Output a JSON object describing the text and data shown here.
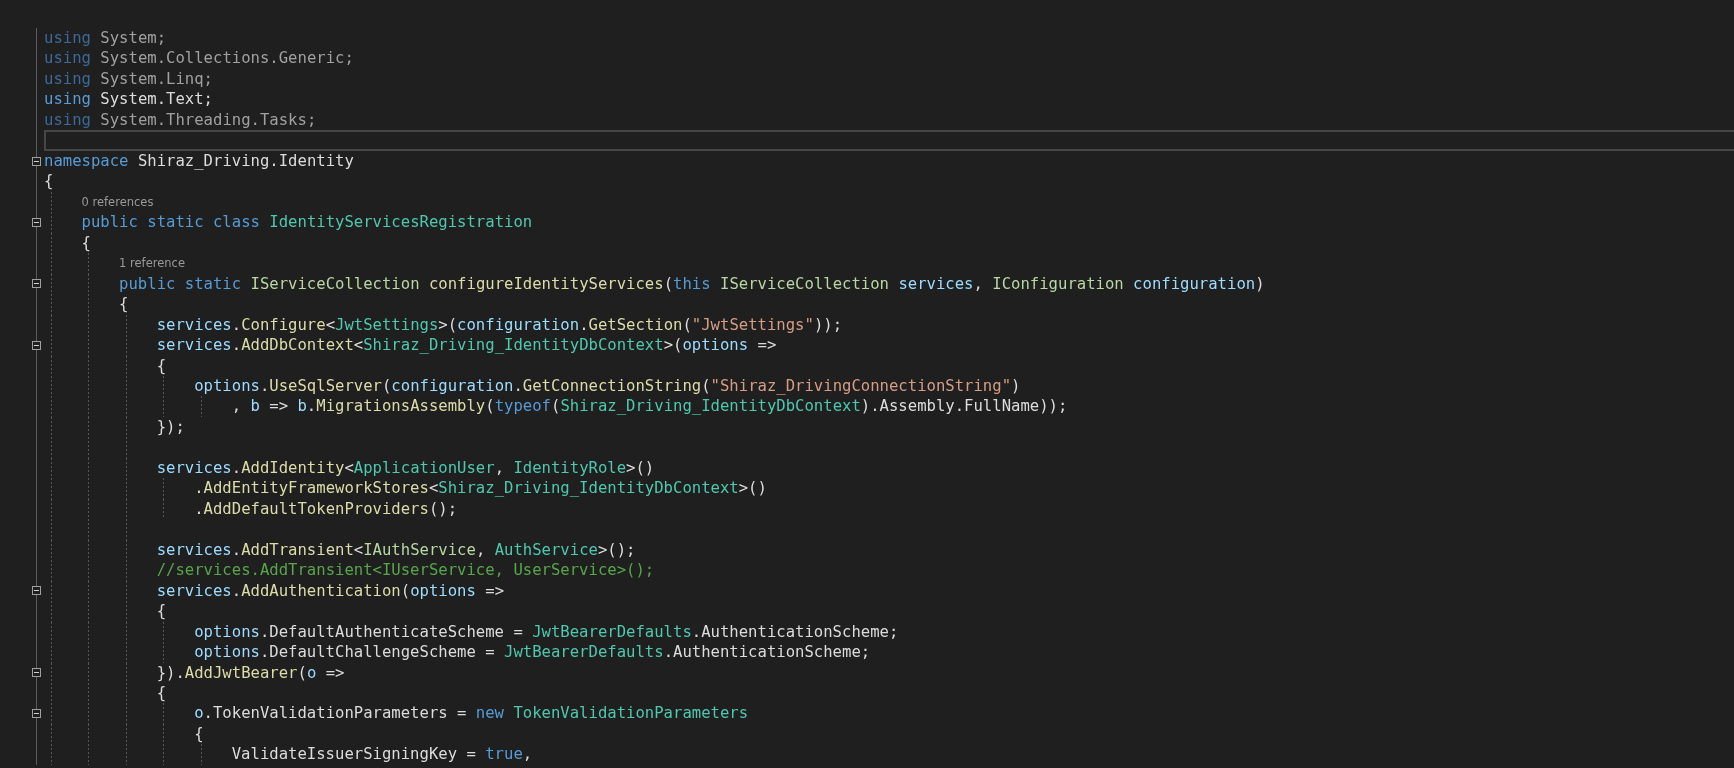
{
  "editor": {
    "lines": [
      {
        "kind": "code",
        "fold": false,
        "current": false,
        "tokens": [
          {
            "text": "using",
            "kind": "kw_dim"
          },
          {
            "text": " System;",
            "kind": "dim"
          }
        ]
      },
      {
        "kind": "code",
        "fold": false,
        "current": false,
        "tokens": [
          {
            "text": "using",
            "kind": "kw_dim"
          },
          {
            "text": " System.Collections.Generic;",
            "kind": "dim"
          }
        ]
      },
      {
        "kind": "code",
        "fold": false,
        "current": false,
        "tokens": [
          {
            "text": "using",
            "kind": "kw_dim"
          },
          {
            "text": " System.Linq;",
            "kind": "dim"
          }
        ]
      },
      {
        "kind": "code",
        "fold": false,
        "current": false,
        "tokens": [
          {
            "text": "using",
            "kind": "kw"
          },
          {
            "text": " System.Text;",
            "kind": "plain"
          }
        ]
      },
      {
        "kind": "code",
        "fold": false,
        "current": false,
        "tokens": [
          {
            "text": "using",
            "kind": "kw_dim"
          },
          {
            "text": " System.Threading.Tasks;",
            "kind": "dim"
          }
        ]
      },
      {
        "kind": "blank",
        "fold": false,
        "current": true
      },
      {
        "kind": "code",
        "fold": true,
        "current": false,
        "tokens": [
          {
            "text": "namespace",
            "kind": "kw"
          },
          {
            "text": " Shiraz_Driving.Identity",
            "kind": "plain"
          }
        ]
      },
      {
        "kind": "code",
        "fold": false,
        "current": false,
        "tokens": [
          {
            "text": "{",
            "kind": "plain"
          }
        ],
        "children": [
          {
            "kind": "codelens",
            "fold": false,
            "current": false,
            "text": "0 references"
          },
          {
            "kind": "code",
            "fold": true,
            "current": false,
            "tokens": [
              {
                "text": "public static class",
                "kind": "kw"
              },
              {
                "text": " IdentityServicesRegistration",
                "kind": "type"
              }
            ]
          },
          {
            "kind": "code",
            "fold": false,
            "current": false,
            "tokens": [
              {
                "text": "{",
                "kind": "plain"
              }
            ],
            "children": [
              {
                "kind": "codelens",
                "fold": false,
                "current": false,
                "text": "1 reference"
              },
              {
                "kind": "code",
                "fold": true,
                "current": false,
                "tokens": [
                  {
                    "text": "public static",
                    "kind": "kw"
                  },
                  {
                    "text": " IServiceCollection",
                    "kind": "iface"
                  },
                  {
                    "text": " configureIdentityServices",
                    "kind": "method"
                  },
                  {
                    "text": "(",
                    "kind": "plain"
                  },
                  {
                    "text": "this",
                    "kind": "kw"
                  },
                  {
                    "text": " IServiceCollection",
                    "kind": "iface"
                  },
                  {
                    "text": " services",
                    "kind": "var"
                  },
                  {
                    "text": ", ",
                    "kind": "plain"
                  },
                  {
                    "text": "IConfiguration",
                    "kind": "iface"
                  },
                  {
                    "text": " configuration",
                    "kind": "var"
                  },
                  {
                    "text": ")",
                    "kind": "plain"
                  }
                ]
              },
              {
                "kind": "code",
                "fold": false,
                "current": false,
                "tokens": [
                  {
                    "text": "{",
                    "kind": "plain"
                  }
                ],
                "children": [
                  {
                    "kind": "code",
                    "fold": false,
                    "current": false,
                    "tokens": [
                      {
                        "text": "services",
                        "kind": "var"
                      },
                      {
                        "text": ".",
                        "kind": "plain"
                      },
                      {
                        "text": "Configure",
                        "kind": "method"
                      },
                      {
                        "text": "<",
                        "kind": "plain"
                      },
                      {
                        "text": "JwtSettings",
                        "kind": "type"
                      },
                      {
                        "text": ">(",
                        "kind": "plain"
                      },
                      {
                        "text": "configuration",
                        "kind": "var"
                      },
                      {
                        "text": ".",
                        "kind": "plain"
                      },
                      {
                        "text": "GetSection",
                        "kind": "method"
                      },
                      {
                        "text": "(",
                        "kind": "plain"
                      },
                      {
                        "text": "\"JwtSettings\"",
                        "kind": "str"
                      },
                      {
                        "text": "));",
                        "kind": "plain"
                      }
                    ]
                  },
                  {
                    "kind": "code",
                    "fold": true,
                    "current": false,
                    "tokens": [
                      {
                        "text": "services",
                        "kind": "var"
                      },
                      {
                        "text": ".",
                        "kind": "plain"
                      },
                      {
                        "text": "AddDbContext",
                        "kind": "method"
                      },
                      {
                        "text": "<",
                        "kind": "plain"
                      },
                      {
                        "text": "Shiraz_Driving_IdentityDbContext",
                        "kind": "type"
                      },
                      {
                        "text": ">(",
                        "kind": "plain"
                      },
                      {
                        "text": "options",
                        "kind": "var"
                      },
                      {
                        "text": " =>",
                        "kind": "plain"
                      }
                    ]
                  },
                  {
                    "kind": "code",
                    "fold": false,
                    "current": false,
                    "tokens": [
                      {
                        "text": "{",
                        "kind": "plain"
                      }
                    ],
                    "children": [
                      {
                        "kind": "code",
                        "fold": false,
                        "current": false,
                        "tokens": [
                          {
                            "text": "options",
                            "kind": "var"
                          },
                          {
                            "text": ".",
                            "kind": "plain"
                          },
                          {
                            "text": "UseSqlServer",
                            "kind": "method"
                          },
                          {
                            "text": "(",
                            "kind": "plain"
                          },
                          {
                            "text": "configuration",
                            "kind": "var"
                          },
                          {
                            "text": ".",
                            "kind": "plain"
                          },
                          {
                            "text": "GetConnectionString",
                            "kind": "method"
                          },
                          {
                            "text": "(",
                            "kind": "plain"
                          },
                          {
                            "text": "\"Shiraz_DrivingConnectionString\"",
                            "kind": "str"
                          },
                          {
                            "text": ")",
                            "kind": "plain"
                          }
                        ],
                        "children": [
                          {
                            "kind": "code",
                            "fold": false,
                            "current": false,
                            "tokens": [
                              {
                                "text": ",",
                                "kind": "plain"
                              },
                              {
                                "text": " b",
                                "kind": "var"
                              },
                              {
                                "text": " => ",
                                "kind": "plain"
                              },
                              {
                                "text": "b",
                                "kind": "var"
                              },
                              {
                                "text": ".",
                                "kind": "plain"
                              },
                              {
                                "text": "MigrationsAssembly",
                                "kind": "method"
                              },
                              {
                                "text": "(",
                                "kind": "plain"
                              },
                              {
                                "text": "typeof",
                                "kind": "kw"
                              },
                              {
                                "text": "(",
                                "kind": "plain"
                              },
                              {
                                "text": "Shiraz_Driving_IdentityDbContext",
                                "kind": "type"
                              },
                              {
                                "text": ").Assembly.FullName));",
                                "kind": "plain"
                              }
                            ]
                          }
                        ]
                      }
                    ]
                  },
                  {
                    "kind": "code",
                    "fold": false,
                    "current": false,
                    "tokens": [
                      {
                        "text": "});",
                        "kind": "plain"
                      }
                    ]
                  },
                  {
                    "kind": "blank",
                    "fold": false,
                    "current": false
                  },
                  {
                    "kind": "code",
                    "fold": false,
                    "current": false,
                    "tokens": [
                      {
                        "text": "services",
                        "kind": "var"
                      },
                      {
                        "text": ".",
                        "kind": "plain"
                      },
                      {
                        "text": "AddIdentity",
                        "kind": "method"
                      },
                      {
                        "text": "<",
                        "kind": "plain"
                      },
                      {
                        "text": "ApplicationUser",
                        "kind": "type"
                      },
                      {
                        "text": ", ",
                        "kind": "plain"
                      },
                      {
                        "text": "IdentityRole",
                        "kind": "type"
                      },
                      {
                        "text": ">()",
                        "kind": "plain"
                      }
                    ],
                    "children": [
                      {
                        "kind": "code",
                        "fold": false,
                        "current": false,
                        "tokens": [
                          {
                            "text": ".",
                            "kind": "plain"
                          },
                          {
                            "text": "AddEntityFrameworkStores",
                            "kind": "method"
                          },
                          {
                            "text": "<",
                            "kind": "plain"
                          },
                          {
                            "text": "Shiraz_Driving_IdentityDbContext",
                            "kind": "type"
                          },
                          {
                            "text": ">()",
                            "kind": "plain"
                          }
                        ]
                      },
                      {
                        "kind": "code",
                        "fold": false,
                        "current": false,
                        "tokens": [
                          {
                            "text": ".",
                            "kind": "plain"
                          },
                          {
                            "text": "AddDefaultTokenProviders",
                            "kind": "method"
                          },
                          {
                            "text": "();",
                            "kind": "plain"
                          }
                        ]
                      }
                    ]
                  },
                  {
                    "kind": "blank",
                    "fold": false,
                    "current": false
                  },
                  {
                    "kind": "code",
                    "fold": false,
                    "current": false,
                    "tokens": [
                      {
                        "text": "services",
                        "kind": "var"
                      },
                      {
                        "text": ".",
                        "kind": "plain"
                      },
                      {
                        "text": "AddTransient",
                        "kind": "method"
                      },
                      {
                        "text": "<",
                        "kind": "plain"
                      },
                      {
                        "text": "IAuthService",
                        "kind": "iface"
                      },
                      {
                        "text": ", ",
                        "kind": "plain"
                      },
                      {
                        "text": "AuthService",
                        "kind": "type"
                      },
                      {
                        "text": ">();",
                        "kind": "plain"
                      }
                    ]
                  },
                  {
                    "kind": "code",
                    "fold": false,
                    "current": false,
                    "tokens": [
                      {
                        "text": "//services.AddTransient<IUserService, UserService>();",
                        "kind": "comment"
                      }
                    ]
                  },
                  {
                    "kind": "code",
                    "fold": true,
                    "current": false,
                    "tokens": [
                      {
                        "text": "services",
                        "kind": "var"
                      },
                      {
                        "text": ".",
                        "kind": "plain"
                      },
                      {
                        "text": "AddAuthentication",
                        "kind": "method"
                      },
                      {
                        "text": "(",
                        "kind": "plain"
                      },
                      {
                        "text": "options",
                        "kind": "var"
                      },
                      {
                        "text": " =>",
                        "kind": "plain"
                      }
                    ]
                  },
                  {
                    "kind": "code",
                    "fold": false,
                    "current": false,
                    "tokens": [
                      {
                        "text": "{",
                        "kind": "plain"
                      }
                    ],
                    "children": [
                      {
                        "kind": "code",
                        "fold": false,
                        "current": false,
                        "tokens": [
                          {
                            "text": "options",
                            "kind": "var"
                          },
                          {
                            "text": ".DefaultAuthenticateScheme = ",
                            "kind": "plain"
                          },
                          {
                            "text": "JwtBearerDefaults",
                            "kind": "type"
                          },
                          {
                            "text": ".AuthenticationScheme;",
                            "kind": "plain"
                          }
                        ]
                      },
                      {
                        "kind": "code",
                        "fold": false,
                        "current": false,
                        "tokens": [
                          {
                            "text": "options",
                            "kind": "var"
                          },
                          {
                            "text": ".DefaultChallengeScheme = ",
                            "kind": "plain"
                          },
                          {
                            "text": "JwtBearerDefaults",
                            "kind": "type"
                          },
                          {
                            "text": ".AuthenticationScheme;",
                            "kind": "plain"
                          }
                        ]
                      }
                    ]
                  },
                  {
                    "kind": "code",
                    "fold": true,
                    "current": false,
                    "tokens": [
                      {
                        "text": "}).",
                        "kind": "plain"
                      },
                      {
                        "text": "AddJwtBearer",
                        "kind": "method"
                      },
                      {
                        "text": "(",
                        "kind": "plain"
                      },
                      {
                        "text": "o",
                        "kind": "var"
                      },
                      {
                        "text": " =>",
                        "kind": "plain"
                      }
                    ]
                  },
                  {
                    "kind": "code",
                    "fold": false,
                    "current": false,
                    "tokens": [
                      {
                        "text": "{",
                        "kind": "plain"
                      }
                    ],
                    "children": [
                      {
                        "kind": "code",
                        "fold": true,
                        "current": false,
                        "tokens": [
                          {
                            "text": "o",
                            "kind": "var"
                          },
                          {
                            "text": ".TokenValidationParameters = ",
                            "kind": "plain"
                          },
                          {
                            "text": "new",
                            "kind": "kw"
                          },
                          {
                            "text": " TokenValidationParameters",
                            "kind": "type"
                          }
                        ]
                      },
                      {
                        "kind": "code",
                        "fold": false,
                        "current": false,
                        "tokens": [
                          {
                            "text": "{",
                            "kind": "plain"
                          }
                        ],
                        "children": [
                          {
                            "kind": "code",
                            "fold": false,
                            "current": false,
                            "tokens": [
                              {
                                "text": "ValidateIssuerSigningKey = ",
                                "kind": "plain"
                              },
                              {
                                "text": "true",
                                "kind": "kw"
                              },
                              {
                                "text": ",",
                                "kind": "plain"
                              }
                            ]
                          }
                        ]
                      }
                    ]
                  }
                ]
              }
            ]
          }
        ]
      }
    ]
  }
}
